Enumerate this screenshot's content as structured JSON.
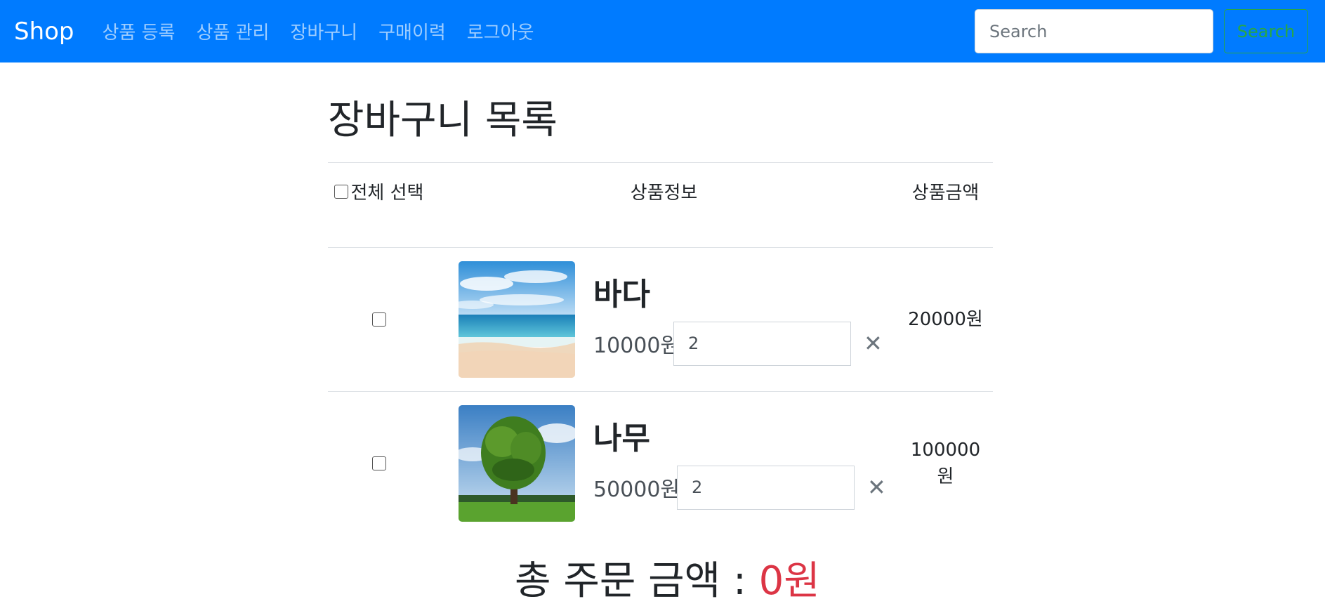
{
  "navbar": {
    "brand": "Shop",
    "links": [
      "상품 등록",
      "상품 관리",
      "장바구니",
      "구매이력",
      "로그아웃"
    ],
    "search_placeholder": "Search",
    "search_button": "Search",
    "colors": {
      "background": "#007bff",
      "search_button": "#28a745"
    }
  },
  "page": {
    "title": "장바구니 목록"
  },
  "table": {
    "headers": {
      "select_all": "전체 선택",
      "product_info": "상품정보",
      "amount": "상품금액"
    },
    "items": [
      {
        "name": "바다",
        "unit_price": "10000원",
        "quantity": "2",
        "line_total": "20000원",
        "image": "sea-beach-photo",
        "checked": false
      },
      {
        "name": "나무",
        "unit_price": "50000원",
        "quantity": "2",
        "line_total": "100000원",
        "image": "tree-photo",
        "checked": false
      }
    ],
    "remove_icon": "close-icon"
  },
  "summary": {
    "label": "총 주문 금액 : ",
    "value": "0원",
    "value_color": "#dc3545"
  }
}
